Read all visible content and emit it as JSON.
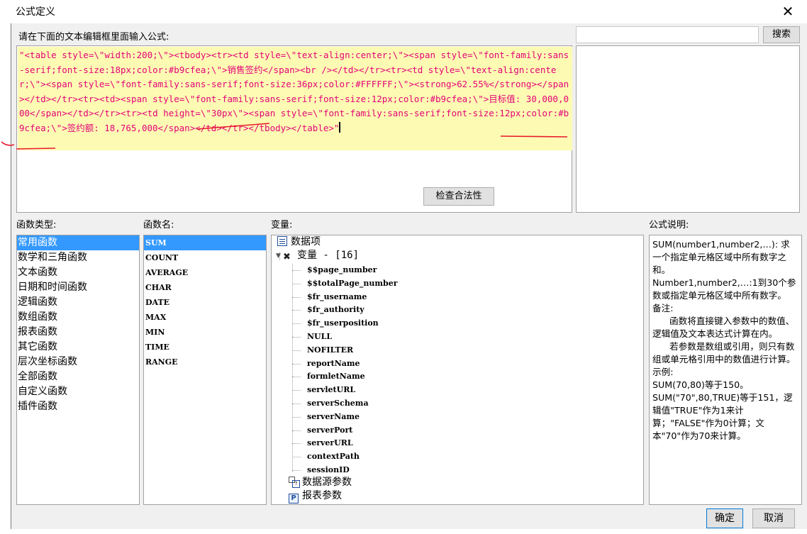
{
  "dialog": {
    "title": "公式定义",
    "close_icon": "close-icon"
  },
  "editor": {
    "prompt": "请在下面的文本编辑框里面输入公式:",
    "formula": "\"<table style=\\\"width:200;\\\"><tbody><tr><td style=\\\"text-align:center;\\\"><span style=\\\"font-family:sans-serif;font-size:18px;color:#b9cfea;\\\">销售签约</span><br /></td></tr><tr><td style=\\\"text-align:center;\\\"><span style=\\\"font-family:sans-serif;font-size:36px;color:#FFFFFF;\\\"><strong>62.55%</strong></span></td></tr><tr><td><span style=\\\"font-family:sans-serif;font-size:12px;color:#b9cfea;\\\">目标值: 30,000,000</span></td></tr><tr><td height=\\\"30px\\\"><span style=\\\"font-family:sans-serif;font-size:12px;color:#b9cfea;\\\">签约额: 18,765,000</span></td></tr></tbody></table>\"",
    "check_button": "检查合法性"
  },
  "search": {
    "placeholder": "",
    "button": "搜索"
  },
  "labels": {
    "function_type": "函数类型:",
    "function_name": "函数名:",
    "variable": "变量:",
    "description": "公式说明:"
  },
  "function_types": [
    "常用函数",
    "数学和三角函数",
    "文本函数",
    "日期和时间函数",
    "逻辑函数",
    "数组函数",
    "报表函数",
    "其它函数",
    "层次坐标函数",
    "全部函数",
    "自定义函数",
    "插件函数"
  ],
  "function_types_selected": 0,
  "function_names": [
    "SUM",
    "COUNT",
    "AVERAGE",
    "CHAR",
    "DATE",
    "MAX",
    "MIN",
    "TIME",
    "RANGE"
  ],
  "function_names_selected": 0,
  "variables": {
    "data_item": "数据项",
    "var_group": "变量 - [16]",
    "var_items": [
      "$$page_number",
      "$$totalPage_number",
      "$fr_username",
      "$fr_authority",
      "$fr_userposition",
      "NULL",
      "NOFILTER",
      "reportName",
      "formletName",
      "servletURL",
      "serverSchema",
      "serverName",
      "serverPort",
      "serverURL",
      "contextPath",
      "sessionID"
    ],
    "datasource_params": "数据源参数",
    "report_params": "报表参数"
  },
  "description": "SUM(number1,number2,…): 求一个指定单元格区域中所有数字之和。\nNumber1,number2,…:1到30个参数或指定单元格区域中所有数字。\n备注:\n      函数将直接键入参数中的数值、逻辑值及文本表达式计算在内。\n      若参数是数组或引用，则只有数组或单元格引用中的数值进行计算。\n示例:\nSUM(70,80)等于150。\nSUM(\"70\",80,TRUE)等于151，逻辑值\"TRUE\"作为1来计算；\"FALSE\"作为0计算；文本\"70\"作为70来计算。",
  "buttons": {
    "ok": "确定",
    "cancel": "取消"
  },
  "colors": {
    "formula_text": "#e40078",
    "highlight": "#fdfbb3",
    "selection": "#3399ff",
    "annotation": "#e8192c"
  }
}
